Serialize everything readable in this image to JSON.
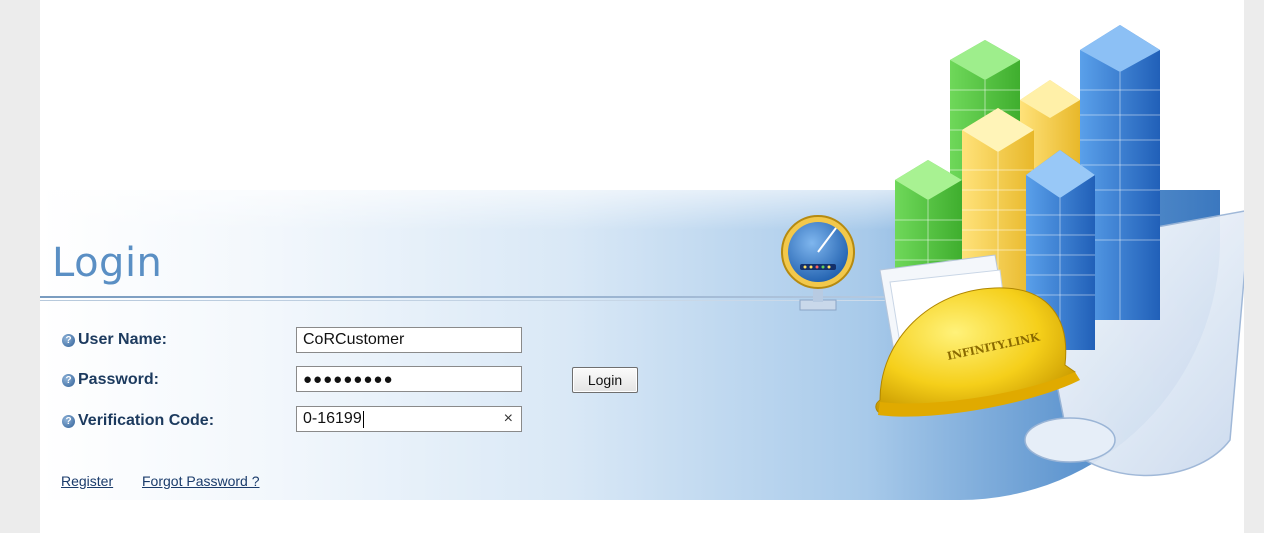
{
  "page": {
    "title": "Login"
  },
  "form": {
    "username": {
      "label": "User Name:",
      "value": "CoRCustomer"
    },
    "password": {
      "label": "Password:",
      "value": "●●●●●●●●●"
    },
    "verification": {
      "label": "Verification Code:",
      "value": "0-16199"
    },
    "login_button": "Login",
    "clear_icon": "×"
  },
  "links": {
    "register": "Register",
    "forgot_password": "Forgot Password ?"
  },
  "icons": {
    "help": "?"
  },
  "branding": {
    "hardhat_text": "INFINITY.LINK"
  },
  "colors": {
    "title": "#5a8fc4",
    "label": "#1c3a5e",
    "band_dark": "#3b78bf"
  }
}
